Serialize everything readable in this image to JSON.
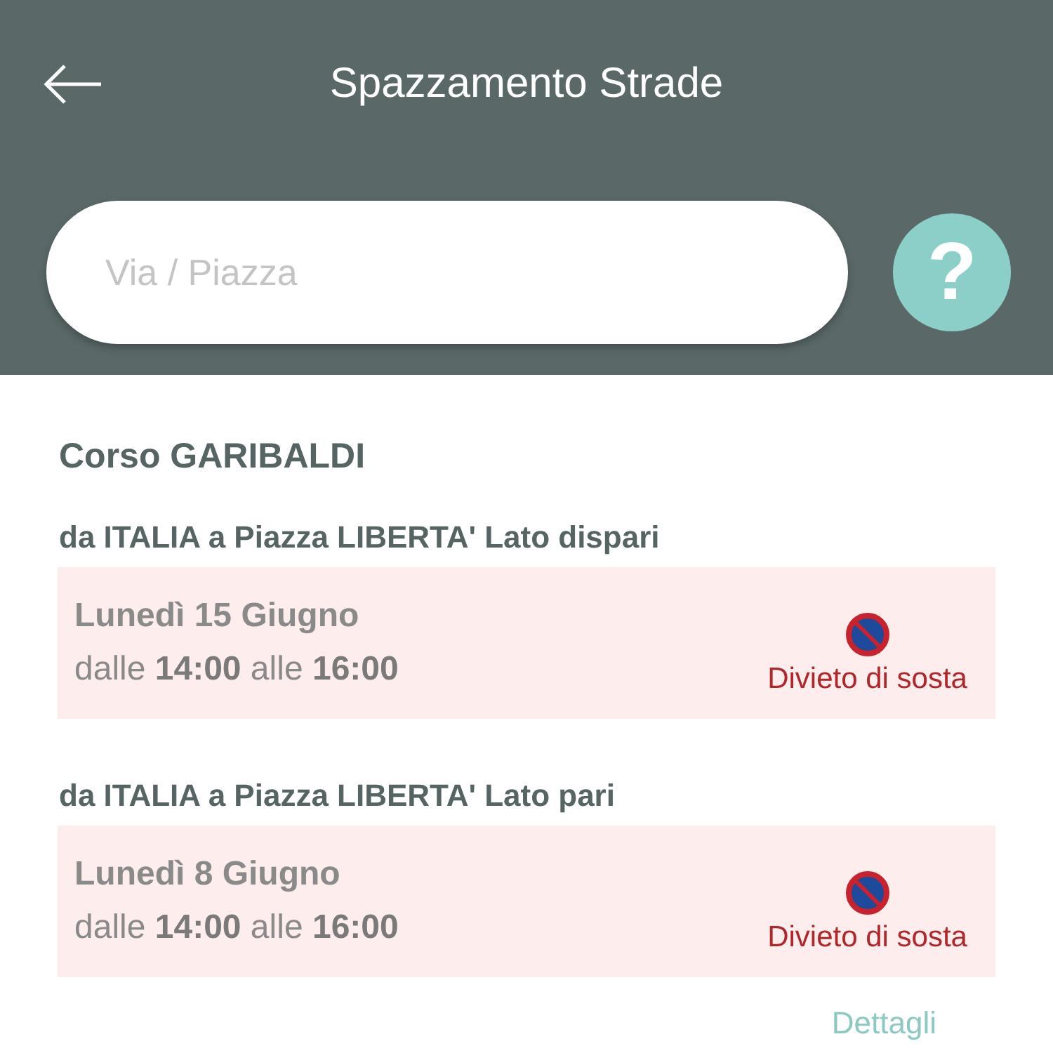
{
  "header": {
    "title": "Spazzamento Strade"
  },
  "search": {
    "placeholder": "Via / Piazza"
  },
  "help_button": {
    "label": "?"
  },
  "street": "Corso GARIBALDI",
  "segments": [
    {
      "label": "da ITALIA a Piazza LIBERTA' Lato dispari",
      "date": "Lunedì 15 Giugno",
      "time": "dalle **14:00** alle **16:00**",
      "restriction": "Divieto di sosta"
    },
    {
      "label": "da ITALIA a Piazza LIBERTA' Lato pari",
      "date": "Lunedì 8 Giugno",
      "time": "dalle **14:00** alle **16:00**",
      "restriction": "Divieto di sosta"
    }
  ],
  "details_link": "Dettagli"
}
